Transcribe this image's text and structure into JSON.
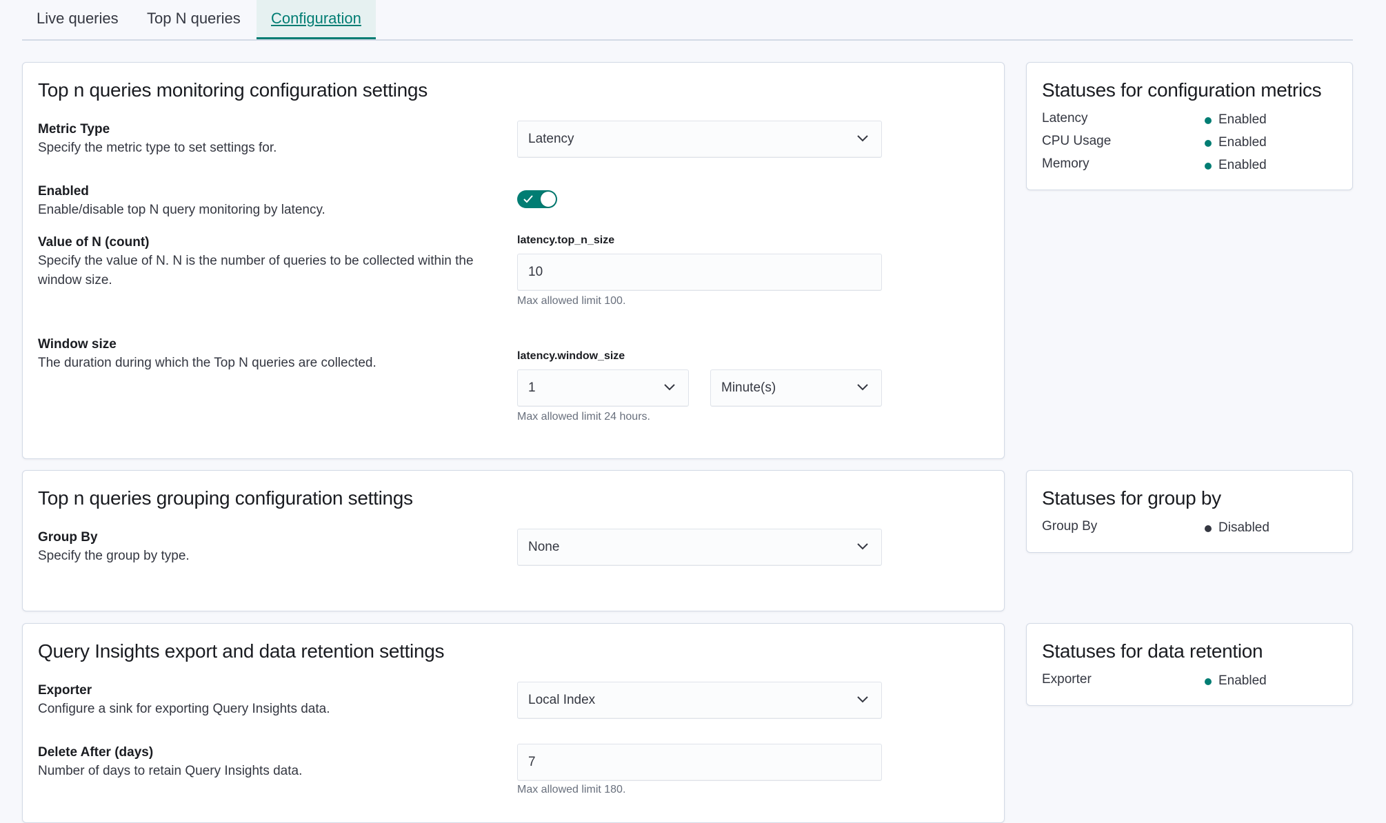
{
  "tabs": [
    {
      "label": "Live queries"
    },
    {
      "label": "Top N queries"
    },
    {
      "label": "Configuration"
    }
  ],
  "monitoring": {
    "title": "Top n queries monitoring configuration settings",
    "metric_type": {
      "label": "Metric Type",
      "desc": "Specify the metric type to set settings for.",
      "value": "Latency"
    },
    "enabled": {
      "label": "Enabled",
      "desc": "Enable/disable top N query monitoring by latency.",
      "on": true
    },
    "top_n": {
      "label": "Value of N (count)",
      "desc": "Specify the value of N. N is the number of queries to be collected within the window size.",
      "ctrl_label": "latency.top_n_size",
      "value": "10",
      "help": "Max allowed limit 100."
    },
    "window": {
      "label": "Window size",
      "desc": "The duration during which the Top N queries are collected.",
      "ctrl_label": "latency.window_size",
      "value": "1",
      "unit": "Minute(s)",
      "help": "Max allowed limit 24 hours."
    }
  },
  "grouping": {
    "title": "Top n queries grouping configuration settings",
    "group_by": {
      "label": "Group By",
      "desc": "Specify the group by type.",
      "value": "None"
    }
  },
  "export": {
    "title": "Query Insights export and data retention settings",
    "exporter": {
      "label": "Exporter",
      "desc": "Configure a sink for exporting Query Insights data.",
      "value": "Local Index"
    },
    "delete_after": {
      "label": "Delete After (days)",
      "desc": "Number of days to retain Query Insights data.",
      "value": "7",
      "help": "Max allowed limit 180."
    }
  },
  "status_metrics": {
    "title": "Statuses for configuration metrics",
    "rows": [
      {
        "name": "Latency",
        "value": "Enabled"
      },
      {
        "name": "CPU Usage",
        "value": "Enabled"
      },
      {
        "name": "Memory",
        "value": "Enabled"
      }
    ]
  },
  "status_group": {
    "title": "Statuses for group by",
    "rows": [
      {
        "name": "Group By",
        "value": "Disabled"
      }
    ]
  },
  "status_retention": {
    "title": "Statuses for data retention",
    "rows": [
      {
        "name": "Exporter",
        "value": "Enabled"
      }
    ]
  },
  "colors": {
    "accent": "#017d73",
    "enabled_dot": "#017d73",
    "disabled_dot": "#343741"
  },
  "icons": {
    "select_chevron": "chevron-down-icon",
    "toggle_check": "check-icon",
    "status_dot": "dot-icon"
  }
}
